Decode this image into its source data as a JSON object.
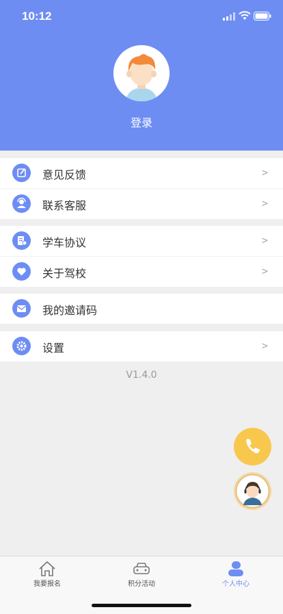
{
  "status": {
    "time": "10:12"
  },
  "profile": {
    "login_label": "登录"
  },
  "menu": {
    "group1": [
      {
        "label": "意见反馈",
        "arrow": ">"
      },
      {
        "label": "联系客服",
        "arrow": ">"
      }
    ],
    "group2": [
      {
        "label": "学车协议",
        "arrow": ">"
      },
      {
        "label": "关于驾校",
        "arrow": ">"
      }
    ],
    "group3": [
      {
        "label": "我的邀请码"
      }
    ],
    "group4": [
      {
        "label": "设置",
        "arrow": ">"
      }
    ]
  },
  "version": "V1.4.0",
  "tabs": [
    {
      "label": "我要报名"
    },
    {
      "label": "积分活动"
    },
    {
      "label": "个人中心"
    }
  ],
  "colors": {
    "accent": "#6e8df3",
    "phone_fab": "#f8c84e",
    "tab_active": "#6e8df3",
    "background": "#efefef"
  }
}
